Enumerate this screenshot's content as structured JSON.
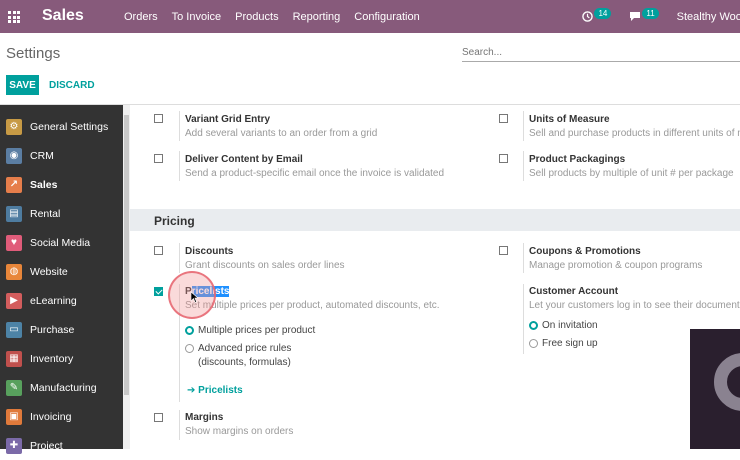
{
  "topbar": {
    "app_name": "Sales",
    "menu": [
      "Orders",
      "To Invoice",
      "Products",
      "Reporting",
      "Configuration"
    ],
    "activity_count": "14",
    "message_count": "11",
    "company": "Stealthy Wood"
  },
  "control": {
    "breadcrumb": "Settings",
    "search_placeholder": "Search...",
    "save_label": "SAVE",
    "discard_label": "DISCARD"
  },
  "sidebar": {
    "items": [
      {
        "label": "General Settings",
        "icon": "gear-icon",
        "color": "#c79a45"
      },
      {
        "label": "CRM",
        "icon": "handshake-icon",
        "color": "#5b7ea3"
      },
      {
        "label": "Sales",
        "icon": "chart-icon",
        "color": "#e67e4b"
      },
      {
        "label": "Rental",
        "icon": "calendar-icon",
        "color": "#4e7ca0"
      },
      {
        "label": "Social Media",
        "icon": "thumbs-up-icon",
        "color": "#e05c7a"
      },
      {
        "label": "Website",
        "icon": "globe-icon",
        "color": "#e8863a"
      },
      {
        "label": "eLearning",
        "icon": "elearning-icon",
        "color": "#d35d5d"
      },
      {
        "label": "Purchase",
        "icon": "purchase-icon",
        "color": "#4d83a6"
      },
      {
        "label": "Inventory",
        "icon": "box-icon",
        "color": "#c0504d"
      },
      {
        "label": "Manufacturing",
        "icon": "wrench-icon",
        "color": "#58a05d"
      },
      {
        "label": "Invoicing",
        "icon": "invoice-icon",
        "color": "#e07a3b"
      },
      {
        "label": "Project",
        "icon": "puzzle-icon",
        "color": "#7b6aa8"
      }
    ]
  },
  "settings": {
    "variant_grid": {
      "title": "Variant Grid Entry",
      "desc": "Add several variants to an order from a grid"
    },
    "units_measure": {
      "title": "Units of Measure",
      "desc": "Sell and purchase products in different units of me"
    },
    "deliver_email": {
      "title": "Deliver Content by Email",
      "desc": "Send a product-specific email once the invoice is validated"
    },
    "packagings": {
      "title": "Product Packagings",
      "desc": "Sell products by multiple of unit # per package"
    },
    "pricing_section": "Pricing",
    "discounts": {
      "title": "Discounts",
      "desc": "Grant discounts on sales order lines"
    },
    "coupons": {
      "title": "Coupons & Promotions",
      "desc": "Manage promotion & coupon programs"
    },
    "pricelists": {
      "title_first": "P",
      "title_rest": "ricelists",
      "desc": "Set multiple prices per product, automated discounts, etc.",
      "option1": "Multiple prices per product",
      "option2_line1": "Advanced price rules",
      "option2_line2": "(discounts, formulas)",
      "link": "Pricelists"
    },
    "customer_account": {
      "title": "Customer Account",
      "desc": "Let your customers log in to see their documents",
      "option1": "On invitation",
      "option2": "Free sign up"
    },
    "margins": {
      "title": "Margins",
      "desc": "Show margins on orders"
    }
  }
}
